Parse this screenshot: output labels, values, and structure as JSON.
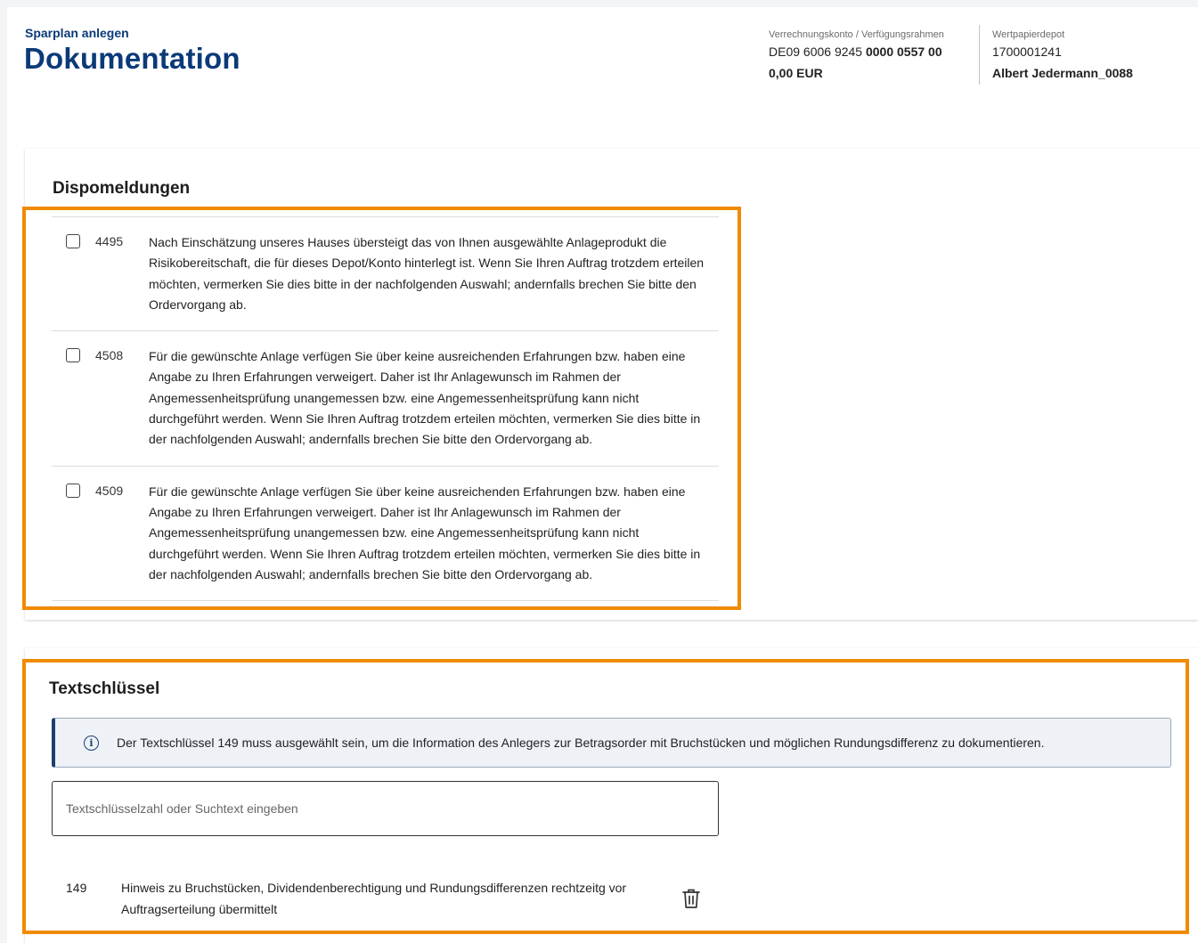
{
  "header": {
    "subtitle": "Sparplan anlegen",
    "title": "Dokumentation"
  },
  "account": {
    "label": "Verrechnungskonto / Verfügungsrahmen",
    "iban_prefix": "DE09 6006 9245",
    "iban_bold": "0000 0557 00",
    "balance": "0,00 EUR"
  },
  "depot": {
    "label": "Wertpapierdepot",
    "number": "1700001241",
    "owner": "Albert Jedermann_0088"
  },
  "dispomeldungen": {
    "title": "Dispomeldungen",
    "items": [
      {
        "code": "4495",
        "text": "Nach Einschätzung unseres Hauses übersteigt das von Ihnen ausgewählte Anlageprodukt die Risikobereitschaft, die für dieses Depot/Konto hinterlegt ist. Wenn Sie Ihren Auftrag trotzdem erteilen möchten, vermerken Sie dies bitte in der nachfolgenden Auswahl; andernfalls brechen Sie bitte den Ordervorgang ab.",
        "checked": false
      },
      {
        "code": "4508",
        "text": "Für die gewünschte Anlage verfügen Sie über keine ausreichenden Erfahrungen bzw. haben eine Angabe zu Ihren Erfahrungen verweigert. Daher ist Ihr Anlagewunsch im Rahmen der Angemessenheitsprüfung unangemessen bzw. eine Angemessenheitsprüfung kann nicht durchgeführt werden. Wenn Sie Ihren Auftrag trotzdem erteilen möchten, vermerken Sie dies bitte in der nachfolgenden Auswahl; andernfalls brechen Sie bitte den Ordervorgang ab.",
        "checked": false
      },
      {
        "code": "4509",
        "text": "Für die gewünschte Anlage verfügen Sie über keine ausreichenden Erfahrungen bzw. haben eine Angabe zu Ihren Erfahrungen verweigert. Daher ist Ihr Anlagewunsch im Rahmen der Angemessenheitsprüfung unangemessen bzw. eine Angemessenheitsprüfung kann nicht durchgeführt werden. Wenn Sie Ihren Auftrag trotzdem erteilen möchten, vermerken Sie dies bitte in der nachfolgenden Auswahl; andernfalls brechen Sie bitte den Ordervorgang ab.",
        "checked": false
      }
    ]
  },
  "textschluessel": {
    "title": "Textschlüssel",
    "info": "Der Textschlüssel 149 muss ausgewählt sein, um die Information des Anlegers zur Betragsorder mit Bruchstücken und möglichen Rundungsdifferenz zu dokumentieren.",
    "search": {
      "placeholder": "Textschlüsselzahl oder Suchtext eingeben",
      "value": ""
    },
    "selected": [
      {
        "code": "149",
        "text": "Hinweis zu Bruchstücken, Dividendenberechtigung und Rundungsdifferenzen rechtzeitg vor Auftragserteilung übermittelt"
      }
    ]
  },
  "icons": {
    "info": "info-icon",
    "delete": "trash-icon"
  },
  "colors": {
    "brand_navy": "#0b3a78",
    "highlight_orange": "#f08a00",
    "info_background": "#eef2f7"
  }
}
